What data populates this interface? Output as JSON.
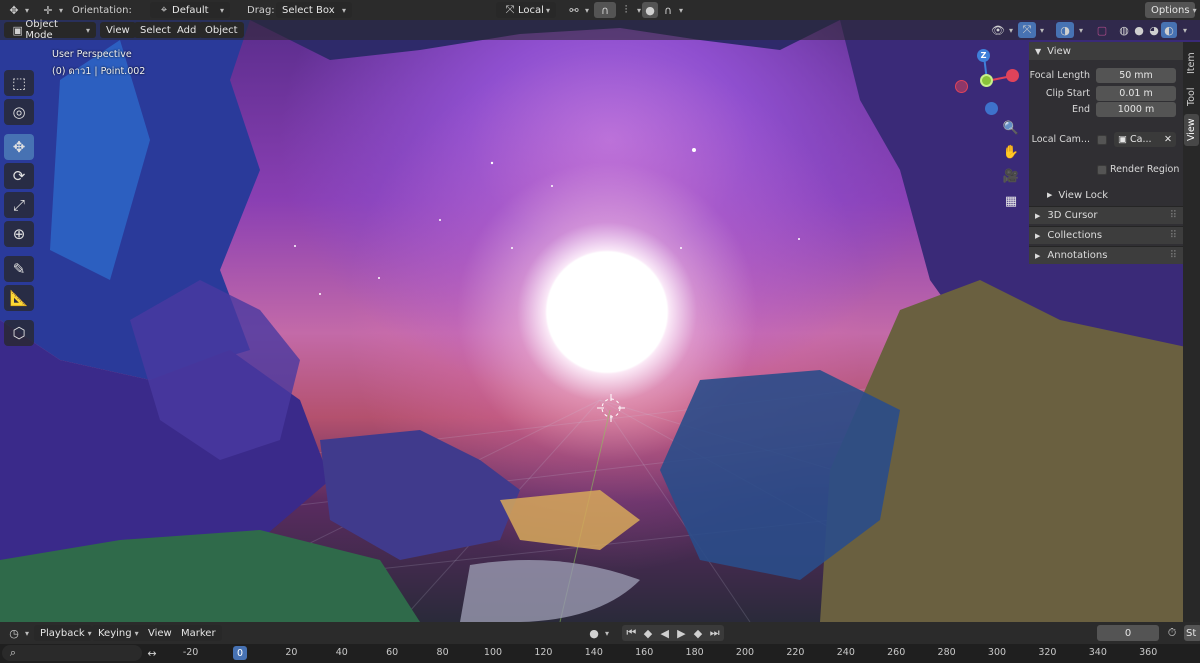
{
  "top_header": {
    "orientation_label": "Orientation:",
    "orientation_value": "Default",
    "drag_label": "Drag:",
    "drag_value": "Select Box",
    "pivot_value": "Local",
    "options_label": "Options"
  },
  "view_header": {
    "mode": "Object Mode",
    "menus": [
      "View",
      "Select",
      "Add",
      "Object"
    ]
  },
  "viewport": {
    "perspective": "User Perspective",
    "object_info": "(0) ดาว1 | Point.002",
    "gizmo_axis_z": "Z"
  },
  "npanel": {
    "section_view": "View",
    "focal_length_label": "Focal Length",
    "focal_length_value": "50 mm",
    "clip_start_label": "Clip Start",
    "clip_start_value": "0.01 m",
    "clip_end_label": "End",
    "clip_end_value": "1000 m",
    "local_camera_label": "Local Cam...",
    "local_camera_value": "Ca...",
    "render_region_label": "Render Region",
    "view_lock": "View Lock",
    "cursor_3d": "3D Cursor",
    "collections": "Collections",
    "annotations": "Annotations"
  },
  "side_tabs": [
    "Item",
    "Tool",
    "View"
  ],
  "timeline": {
    "playback": "Playback",
    "keying": "Keying",
    "view": "View",
    "marker": "Marker",
    "current_frame": "0",
    "start_label": "St",
    "current_marker": "0",
    "ticks": [
      "-20",
      "20",
      "40",
      "60",
      "80",
      "100",
      "120",
      "140",
      "160",
      "180",
      "200",
      "220",
      "240",
      "260",
      "280",
      "300",
      "320",
      "340",
      "360"
    ]
  },
  "colors": {
    "accent": "#4772b3",
    "axis_x": "#e0435a",
    "axis_y": "#8ac43a",
    "axis_z": "#3f7fd9"
  }
}
